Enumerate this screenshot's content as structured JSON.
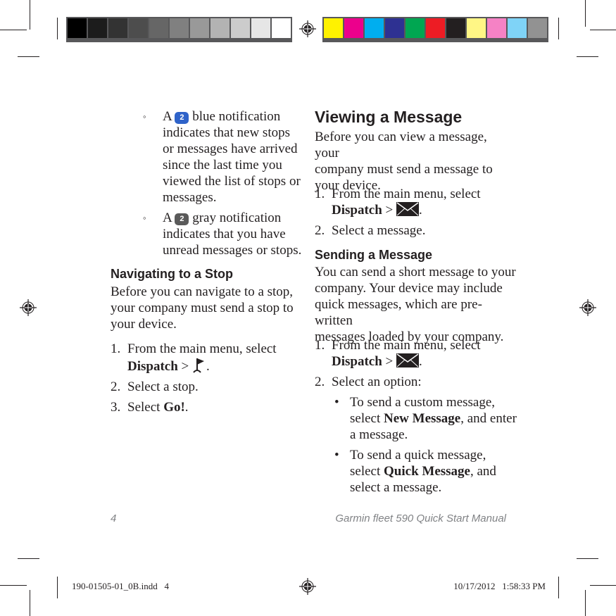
{
  "color_bar": {
    "grayscale": [
      "#000000",
      "#1c1c1c",
      "#333333",
      "#4d4d4d",
      "#666666",
      "#808080",
      "#999999",
      "#b3b3b3",
      "#cccccc",
      "#e6e6e6",
      "#ffffff"
    ],
    "process": [
      "#fff200",
      "#ec008c",
      "#00aeef",
      "#2e3192",
      "#00a651",
      "#ed1c24",
      "#231f20",
      "#fff685",
      "#f582c5",
      "#7fd3f7",
      "#929292"
    ]
  },
  "left_column": {
    "notifications": [
      {
        "bullet": "◦",
        "prefix": "A",
        "badge_number": "2",
        "badge_color": "#2f63c9",
        "text": "blue notification indicates that new stops or messages have arrived since the last time you viewed the list of stops or messages.",
        "lines": [
          "blue notification",
          "indicates that new stops",
          "or messages have arrived",
          "since the last time you",
          "viewed the list of stops or",
          "messages."
        ]
      },
      {
        "bullet": "◦",
        "prefix": "A",
        "badge_number": "2",
        "badge_color": "#5a5a5a",
        "text": "gray notification indicates that you have unread messages or stops.",
        "lines": [
          "gray notification",
          "indicates that you have",
          "unread messages or stops."
        ]
      }
    ],
    "section": {
      "heading": "Navigating to a Stop",
      "intro_lines": [
        "Before you can navigate to a stop,",
        "your company must send a stop to",
        "your device."
      ],
      "steps": [
        {
          "num": "1.",
          "line1": "From the main menu, select",
          "bold": "Dispatch",
          "sep": " > ",
          "icon": "flag-icon",
          "end": "."
        },
        {
          "num": "2.",
          "text": "Select a stop."
        },
        {
          "num": "3.",
          "pre": "Select ",
          "bold": "Go!",
          "end": "."
        }
      ]
    }
  },
  "right_column": {
    "viewing": {
      "heading": "Viewing a Message",
      "intro_lines": [
        "Before you can view a message, your",
        "company must send a message to",
        "your device."
      ],
      "steps": [
        {
          "num": "1.",
          "line1": "From the main menu, select",
          "bold": "Dispatch",
          "sep": " > ",
          "icon": "envelope-icon",
          "end": "."
        },
        {
          "num": "2.",
          "text": "Select a message."
        }
      ]
    },
    "sending": {
      "heading": "Sending a Message",
      "intro_lines": [
        "You can send a short message to your",
        "company. Your device may include",
        "quick messages, which are pre-written",
        "messages loaded by your company."
      ],
      "steps": [
        {
          "num": "1.",
          "line1": "From the main menu, select",
          "bold": "Dispatch",
          "sep": " > ",
          "icon": "envelope-icon",
          "end": "."
        },
        {
          "num": "2.",
          "text": "Select an option:"
        }
      ],
      "options": [
        {
          "bullet": "•",
          "line1": "To send a custom message,",
          "pre": "select ",
          "bold": "New Message",
          "post": ", and enter",
          "line3": "a message."
        },
        {
          "bullet": "•",
          "line1": "To send a quick message,",
          "pre": "select ",
          "bold": "Quick Message",
          "post": ", and",
          "line3": "select a message."
        }
      ]
    }
  },
  "footer": {
    "page_number": "4",
    "manual_title": "Garmin fleet 590 Quick Start Manual"
  },
  "slug": {
    "file": "190-01505-01_0B.indd   4",
    "timestamp": "10/17/2012   1:58:33 PM"
  }
}
